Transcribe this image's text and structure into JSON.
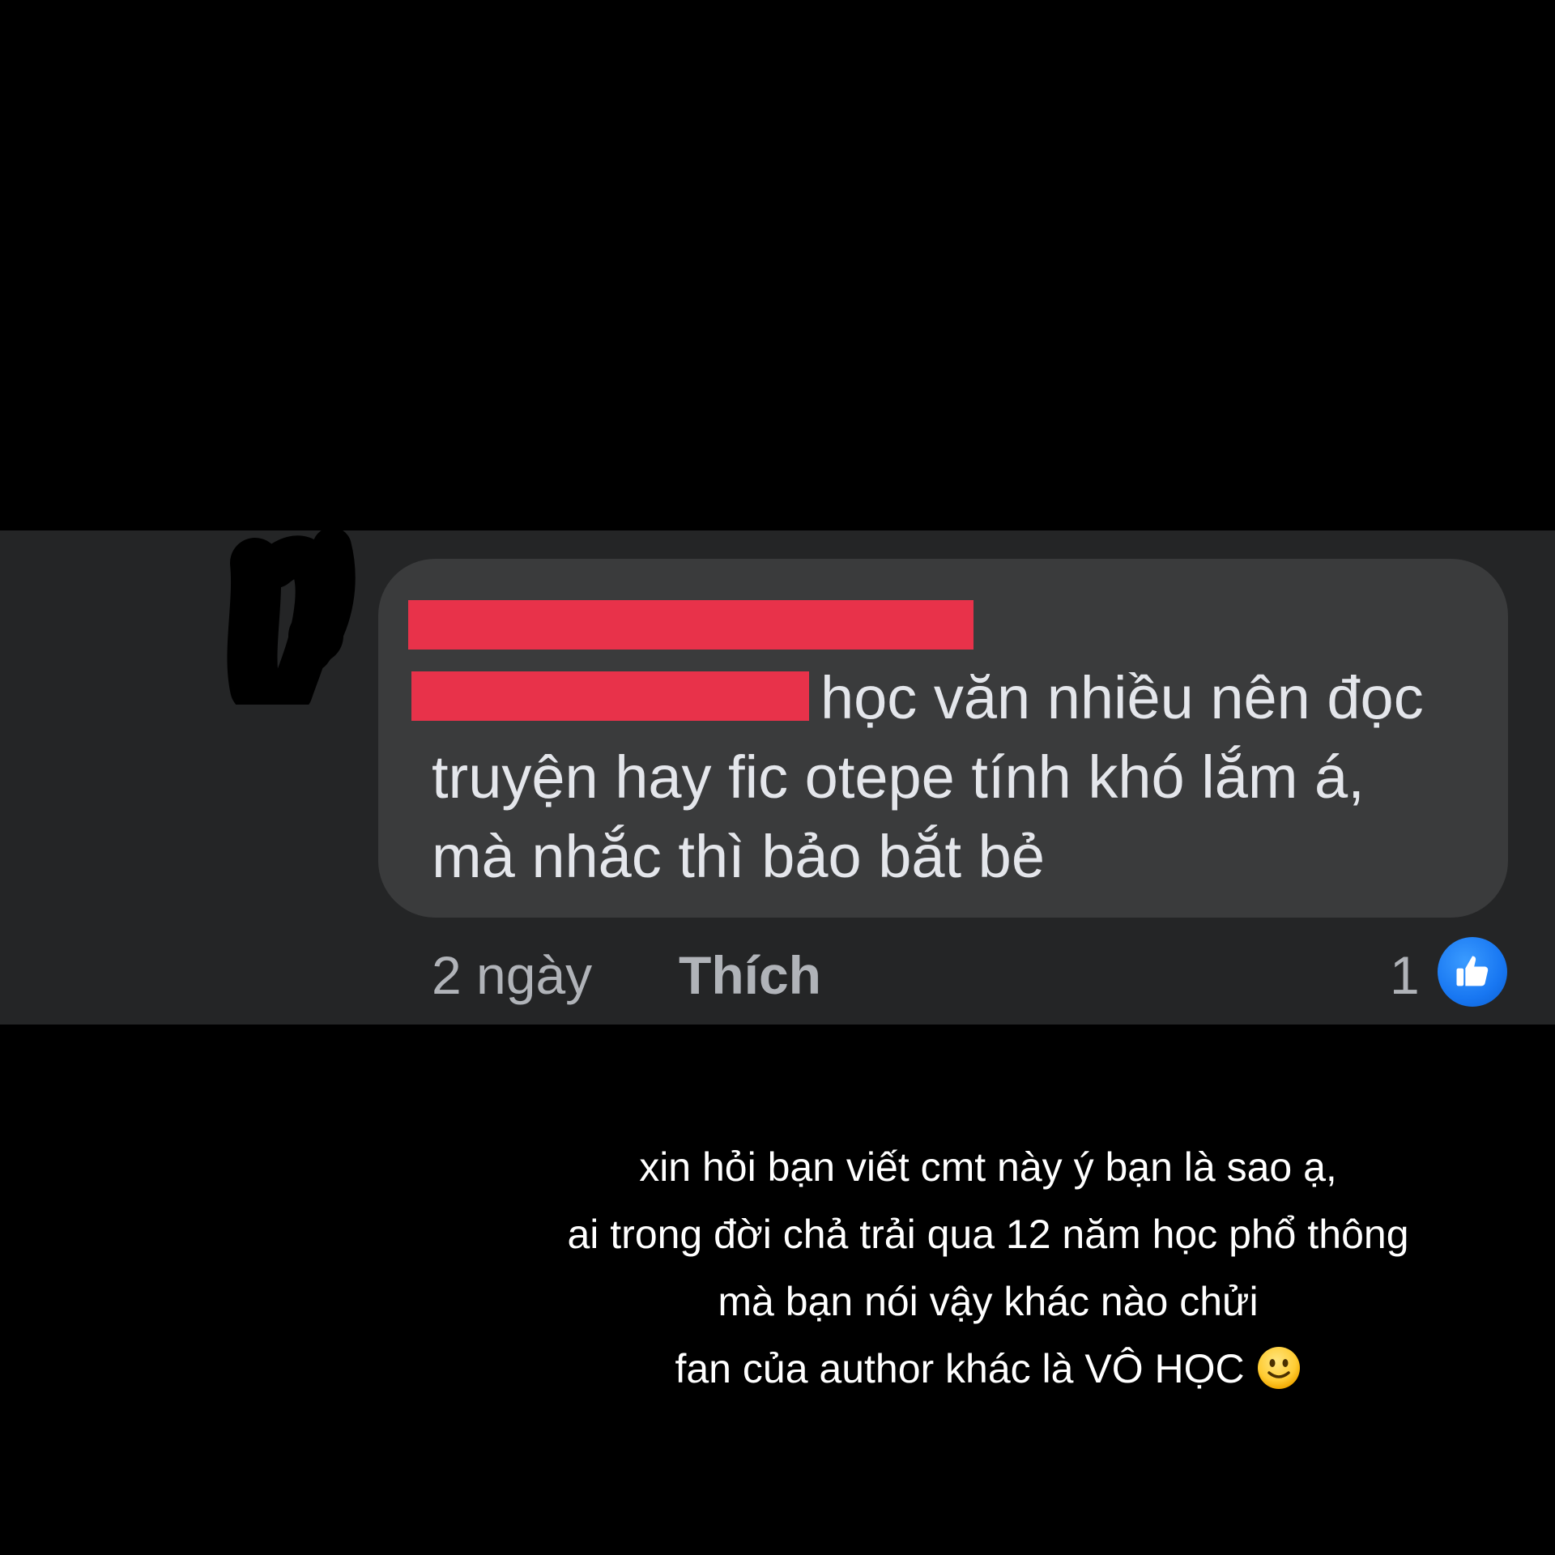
{
  "comment": {
    "text_line1": "học văn nhiều nên đọc",
    "text_line2": "truyện hay fic otepe tính khó lắm á,",
    "text_line3": "mà nhắc thì bảo bắt bẻ",
    "time": "2 ngày",
    "like_label": "Thích",
    "reaction_count": "1",
    "reaction_icon": "thumbs-up-icon"
  },
  "caption": {
    "lines": [
      "xin hỏi bạn viết cmt này ý bạn là sao ạ,",
      "ai trong đời chả trải qua 12 năm học phổ thông",
      "mà bạn nói vậy khác nào chửi",
      "fan của author khác là VÔ HỌC"
    ],
    "emoji": "slightly-smiling-face-icon"
  },
  "colors": {
    "page_bg": "#000000",
    "strip_bg": "#242526",
    "bubble_bg": "#3a3b3c",
    "redaction": "#e8324a",
    "like_blue": "#1877f2",
    "text_light": "#e4e6eb",
    "text_muted": "#b0b3b8"
  }
}
